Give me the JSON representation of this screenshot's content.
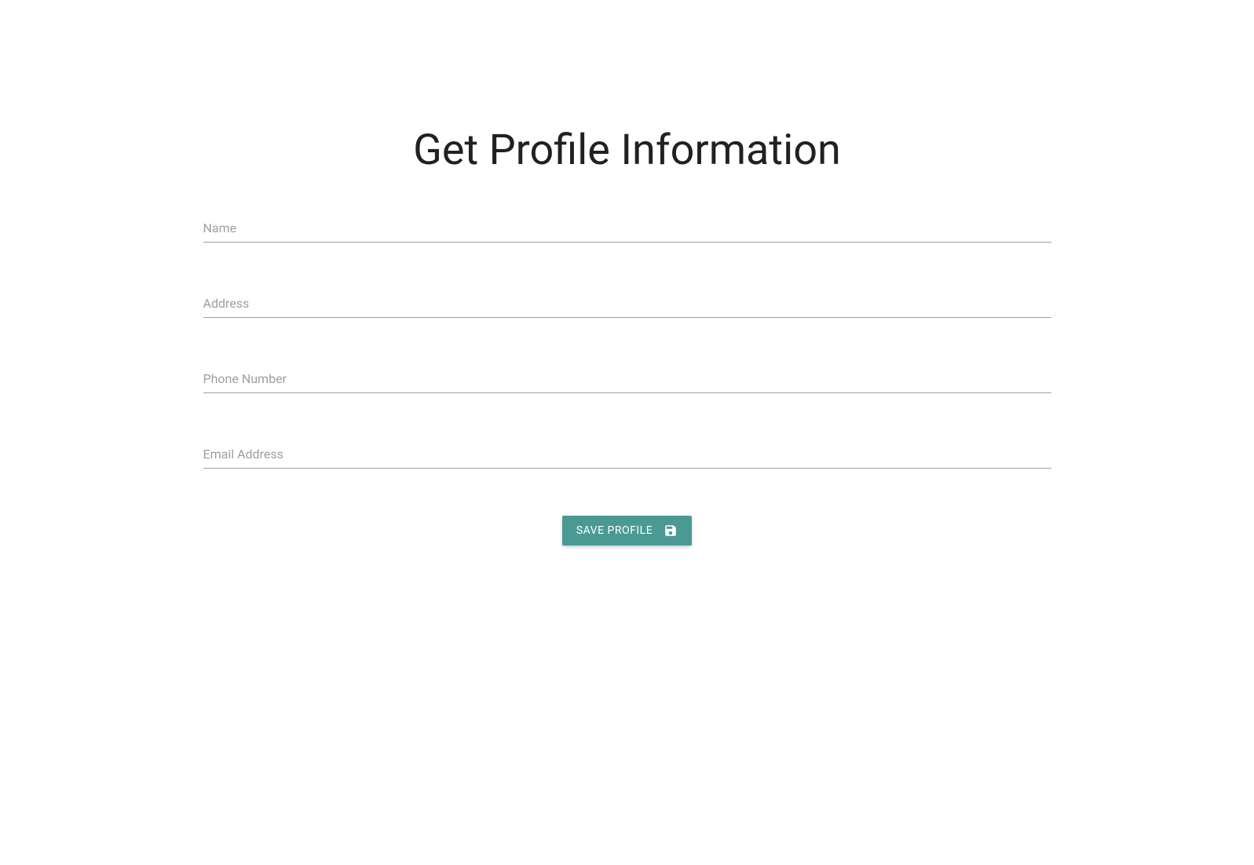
{
  "header": {
    "title": "Get Profile Information"
  },
  "form": {
    "name": {
      "placeholder": "Name",
      "value": ""
    },
    "address": {
      "placeholder": "Address",
      "value": ""
    },
    "phone": {
      "placeholder": "Phone Number",
      "value": ""
    },
    "email": {
      "placeholder": "Email Address",
      "value": ""
    }
  },
  "actions": {
    "save_label": "SAVE PROFILE"
  }
}
